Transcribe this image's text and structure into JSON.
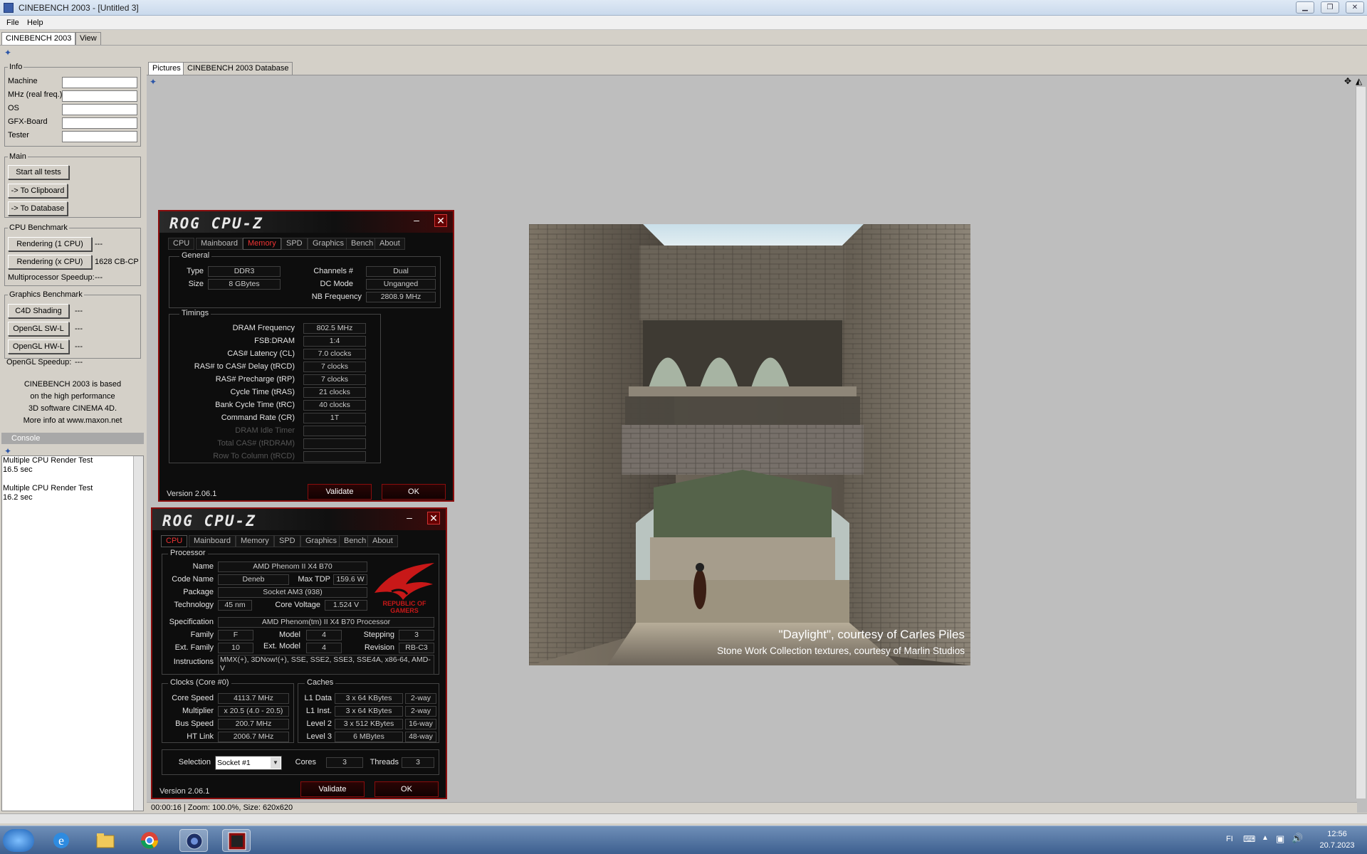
{
  "window": {
    "title": "CINEBENCH 2003 - [Untitled 3]"
  },
  "menu": {
    "file": "File",
    "help": "Help"
  },
  "toptabs": {
    "cinebench": "CINEBENCH 2003",
    "view": "View"
  },
  "info": {
    "title": "Info",
    "machine": "Machine",
    "mhz": "MHz (real freq.)",
    "os": "OS",
    "gfx": "GFX-Board",
    "tester": "Tester"
  },
  "main": {
    "title": "Main",
    "start": "Start all tests",
    "clipboard": "-> To Clipboard",
    "database": "-> To Database"
  },
  "cpu_bench": {
    "title": "CPU Benchmark",
    "render1": "Rendering (1 CPU)",
    "render1_val": "---",
    "renderx": "Rendering (x CPU)",
    "renderx_val": "1628 CB-CPU",
    "speedup": "Multiprocessor Speedup:",
    "speedup_val": "---"
  },
  "gfx_bench": {
    "title": "Graphics Benchmark",
    "c4d": "C4D Shading",
    "c4d_val": "---",
    "swl": "OpenGL SW-L",
    "swl_val": "---",
    "hwl": "OpenGL HW-L",
    "hwl_val": "---",
    "speedup": "OpenGL Speedup:",
    "speedup_val": "---"
  },
  "about_text": {
    "l1": "CINEBENCH 2003 is based",
    "l2": "on the high performance",
    "l3": "3D software CINEMA 4D.",
    "l4": "More info at www.maxon.net"
  },
  "console": {
    "title": "Console",
    "lines": [
      "Multiple CPU Render Test",
      "16.5 sec",
      "",
      "Multiple CPU Render Test",
      "16.2 sec"
    ]
  },
  "subtabs": {
    "pictures": "Pictures",
    "database": "CINEBENCH 2003 Database"
  },
  "image": {
    "caption1": "\"Daylight\", courtesy of Carles Piles",
    "caption2": "Stone Work Collection textures, courtesy of Marlin Studios"
  },
  "status": {
    "text": "00:00:16 | Zoom: 100.0%, Size: 620x620"
  },
  "taskbar": {
    "lang": "FI",
    "time": "12:56",
    "date": "20.7.2023"
  },
  "cpuz_memory": {
    "logo": "ROG CPU-Z",
    "tabs": [
      "CPU",
      "Mainboard",
      "Memory",
      "SPD",
      "Graphics",
      "Bench",
      "About"
    ],
    "active_tab": "Memory",
    "general_title": "General",
    "type_lbl": "Type",
    "type_val": "DDR3",
    "size_lbl": "Size",
    "size_val": "8 GBytes",
    "channels_lbl": "Channels #",
    "channels_val": "Dual",
    "dcmode_lbl": "DC Mode",
    "dcmode_val": "Unganged",
    "nbfreq_lbl": "NB Frequency",
    "nbfreq_val": "2808.9 MHz",
    "timings_title": "Timings",
    "timings": [
      {
        "label": "DRAM Frequency",
        "value": "802.5 MHz",
        "dim": false
      },
      {
        "label": "FSB:DRAM",
        "value": "1:4",
        "dim": false
      },
      {
        "label": "CAS# Latency (CL)",
        "value": "7.0 clocks",
        "dim": false
      },
      {
        "label": "RAS# to CAS# Delay (tRCD)",
        "value": "7 clocks",
        "dim": false
      },
      {
        "label": "RAS# Precharge (tRP)",
        "value": "7 clocks",
        "dim": false
      },
      {
        "label": "Cycle Time (tRAS)",
        "value": "21 clocks",
        "dim": false
      },
      {
        "label": "Bank Cycle Time (tRC)",
        "value": "40 clocks",
        "dim": false
      },
      {
        "label": "Command Rate (CR)",
        "value": "1T",
        "dim": false
      },
      {
        "label": "DRAM Idle Timer",
        "value": "",
        "dim": true
      },
      {
        "label": "Total CAS# (tRDRAM)",
        "value": "",
        "dim": true
      },
      {
        "label": "Row To Column (tRCD)",
        "value": "",
        "dim": true
      }
    ],
    "version": "Version 2.06.1",
    "validate": "Validate",
    "ok": "OK"
  },
  "cpuz_cpu": {
    "logo": "ROG CPU-Z",
    "tabs": [
      "CPU",
      "Mainboard",
      "Memory",
      "SPD",
      "Graphics",
      "Bench",
      "About"
    ],
    "active_tab": "CPU",
    "processor_title": "Processor",
    "name_lbl": "Name",
    "name_val": "AMD Phenom II X4 B70",
    "codename_lbl": "Code Name",
    "codename_val": "Deneb",
    "maxtdp_lbl": "Max TDP",
    "maxtdp_val": "159.6 W",
    "package_lbl": "Package",
    "package_val": "Socket AM3 (938)",
    "tech_lbl": "Technology",
    "tech_val": "45 nm",
    "corev_lbl": "Core Voltage",
    "corev_val": "1.524 V",
    "spec_lbl": "Specification",
    "spec_val": "AMD Phenom(tm) II X4 B70 Processor",
    "family_lbl": "Family",
    "family_val": "F",
    "model_lbl": "Model",
    "model_val": "4",
    "stepping_lbl": "Stepping",
    "stepping_val": "3",
    "extfam_lbl": "Ext. Family",
    "extfam_val": "10",
    "extmodel_lbl": "Ext. Model",
    "extmodel_val": "4",
    "revision_lbl": "Revision",
    "revision_val": "RB-C3",
    "instr_lbl": "Instructions",
    "instr_val": "MMX(+), 3DNow!(+), SSE, SSE2, SSE3, SSE4A, x86-64, AMD-V",
    "rog_text1": "REPUBLIC OF",
    "rog_text2": "GAMERS",
    "clocks_title": "Clocks (Core #0)",
    "corespeed_lbl": "Core Speed",
    "corespeed_val": "4113.7 MHz",
    "mult_lbl": "Multiplier",
    "mult_val": "x 20.5 (4.0 - 20.5)",
    "bus_lbl": "Bus Speed",
    "bus_val": "200.7 MHz",
    "ht_lbl": "HT Link",
    "ht_val": "2006.7 MHz",
    "caches_title": "Caches",
    "l1d_lbl": "L1 Data",
    "l1d_val": "3 x 64 KBytes",
    "l1d_way": "2-way",
    "l1i_lbl": "L1 Inst.",
    "l1i_val": "3 x 64 KBytes",
    "l1i_way": "2-way",
    "l2_lbl": "Level 2",
    "l2_val": "3 x 512 KBytes",
    "l2_way": "16-way",
    "l3_lbl": "Level 3",
    "l3_val": "6 MBytes",
    "l3_way": "48-way",
    "selection_lbl": "Selection",
    "selection_val": "Socket #1",
    "cores_lbl": "Cores",
    "cores_val": "3",
    "threads_lbl": "Threads",
    "threads_val": "3",
    "version": "Version 2.06.1",
    "validate": "Validate",
    "ok": "OK"
  }
}
